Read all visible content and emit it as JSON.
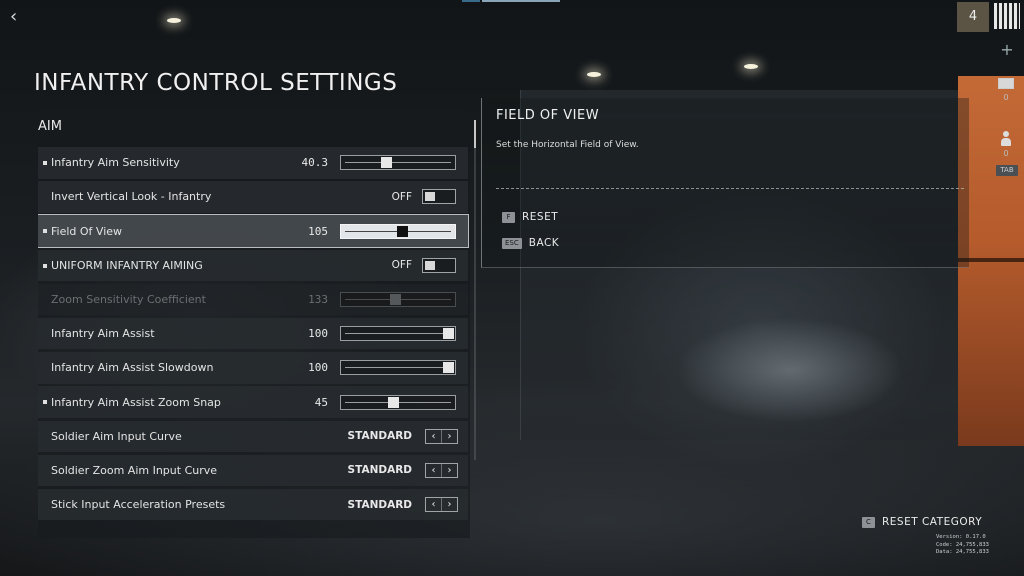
{
  "title": "INFANTRY CONTROL SETTINGS",
  "header": {
    "level": "4",
    "mail_count": "0",
    "squad_count": "0",
    "tab_key": "TAB"
  },
  "section": "AIM",
  "settings": [
    {
      "label": "Infantry Aim Sensitivity",
      "value": "40.3",
      "control": "slider",
      "level": 0.38,
      "modified": true,
      "selected": false,
      "disabled": false
    },
    {
      "label": "Invert Vertical Look - Infantry",
      "value": "OFF",
      "control": "toggle",
      "modified": false,
      "selected": false,
      "disabled": false
    },
    {
      "label": "Field Of View",
      "value": "105",
      "control": "slider",
      "level": 0.54,
      "modified": true,
      "selected": true,
      "disabled": false
    },
    {
      "label": "UNIFORM INFANTRY AIMING",
      "value": "OFF",
      "control": "toggle",
      "modified": true,
      "selected": false,
      "disabled": false
    },
    {
      "label": "Zoom Sensitivity Coefficient",
      "value": "133",
      "control": "slider",
      "level": 0.47,
      "modified": false,
      "selected": false,
      "disabled": true
    },
    {
      "label": "Infantry Aim Assist",
      "value": "100",
      "control": "slider",
      "level": 1.0,
      "modified": false,
      "selected": false,
      "disabled": false
    },
    {
      "label": "Infantry Aim Assist Slowdown",
      "value": "100",
      "control": "slider",
      "level": 1.0,
      "modified": false,
      "selected": false,
      "disabled": false
    },
    {
      "label": "Infantry Aim Assist Zoom Snap",
      "value": "45",
      "control": "slider",
      "level": 0.45,
      "modified": true,
      "selected": false,
      "disabled": false
    },
    {
      "label": "Soldier Aim Input Curve",
      "value": "STANDARD",
      "control": "select",
      "modified": false,
      "selected": false,
      "disabled": false
    },
    {
      "label": "Soldier Zoom Aim Input Curve",
      "value": "STANDARD",
      "control": "select",
      "modified": false,
      "selected": false,
      "disabled": false
    },
    {
      "label": "Stick Input Acceleration Presets",
      "value": "STANDARD",
      "control": "select",
      "modified": false,
      "selected": false,
      "disabled": false
    }
  ],
  "description": {
    "title": "FIELD OF VIEW",
    "text": "Set the Horizontal Field of View."
  },
  "actions": {
    "reset_key": "F",
    "reset_label": "RESET",
    "back_key": "ESC",
    "back_label": "BACK",
    "reset_category_key": "C",
    "reset_category_label": "RESET CATEGORY"
  },
  "version": {
    "version": "Version: 0.17.0",
    "code": "Code: 24,755,833",
    "data": "Data: 24,755,833"
  }
}
